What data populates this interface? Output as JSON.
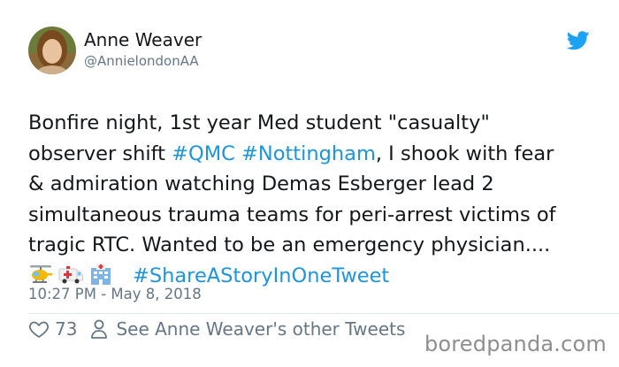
{
  "user": {
    "name": "Anne Weaver",
    "handle": "@AnnielondonAA"
  },
  "tweet": {
    "line1": "Bonfire night, 1st year Med student \"casualty\"",
    "line2_pre": "observer shift ",
    "hashtag_qmc": "#QMC",
    "line2_space": " ",
    "hashtag_nottingham": "#Nottingham",
    "line2_post": ", I shook with fear",
    "line3": "& admiration watching Demas Esberger lead 2",
    "line4": "simultaneous trauma teams for peri-arrest victims of",
    "line5": "tragic RTC. Wanted to be an emergency physician....",
    "emojis": [
      "helicopter-icon",
      "ambulance-icon",
      "hospital-icon"
    ],
    "hashtag_story": "#ShareAStoryInOneTweet"
  },
  "timestamp": "10:27 PM - May 8, 2018",
  "actions": {
    "likes": "73",
    "see_other": "See Anne Weaver's other Tweets"
  },
  "watermark": "boredpanda.com",
  "colors": {
    "link": "#1b95e0",
    "muted": "#657786",
    "twitter_blue": "#1da1f2"
  }
}
